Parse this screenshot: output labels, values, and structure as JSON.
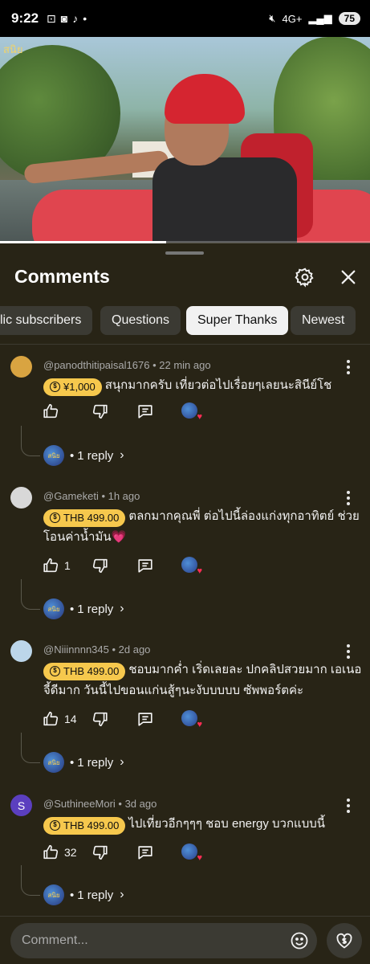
{
  "status_bar": {
    "time": "9:22",
    "network": "4G+",
    "battery": "75"
  },
  "video": {
    "watermark": "สนิย"
  },
  "panel": {
    "title": "Comments"
  },
  "filters": [
    "lic subscribers",
    "Questions",
    "Super Thanks",
    "Newest"
  ],
  "active_filter": "Super Thanks",
  "comments": [
    {
      "handle": "@panodthitipaisal1676",
      "time": "22 min ago",
      "tip": "¥1,000",
      "text": "สนุกมากครับ เที่ยวต่อไปเรื่อยๆเลยนะสินีย์โช",
      "likes": "",
      "reply_label": "1 reply",
      "avatar_color": "#d9a441"
    },
    {
      "handle": "@Gameketi",
      "time": "1h ago",
      "tip": "THB 499.00",
      "text": "ตลกมากคุณพี่ ต่อไปนี้ล่องแก่งทุกอาทิตย์ ช่วยโอนค่าน้ำมัน💗",
      "likes": "1",
      "reply_label": "1 reply",
      "avatar_color": "#d8d8d8"
    },
    {
      "handle": "@Niiinnnn345",
      "time": "2d ago",
      "tip": "THB 499.00",
      "text": "ชอบมากค่ำ เริ่ดเลยละ ปกคลิปสวยมาก เอเนอจี้ดีมาก วันนี้ไปขอนแก่นสู้ๆนะงับบบบบ ซัพพอร์ตค่ะ",
      "likes": "14",
      "reply_label": "1 reply",
      "avatar_color": "#bcd6ea"
    },
    {
      "handle": "@SuthineeMori",
      "time": "3d ago",
      "tip": "THB 499.00",
      "text": "ไปเที่ยวอีกๆๆๆ ชอบ energy บวกแบบนี้",
      "likes": "32",
      "reply_label": "1 reply",
      "avatar_color": "#5b3fbf",
      "avatar_letter": "S"
    }
  ],
  "composer": {
    "placeholder": "Comment..."
  },
  "colors": {
    "tip": "#f6c84d",
    "background": "#282416",
    "chip_active": "#f1f1f1",
    "chip": "#3b3a33"
  },
  "icons": [
    "gear-icon",
    "close-icon",
    "thumbs-up-icon",
    "thumbs-down-icon",
    "reply-icon",
    "more-icon",
    "emoji-icon",
    "super-thanks-icon",
    "chevron-right-icon"
  ]
}
